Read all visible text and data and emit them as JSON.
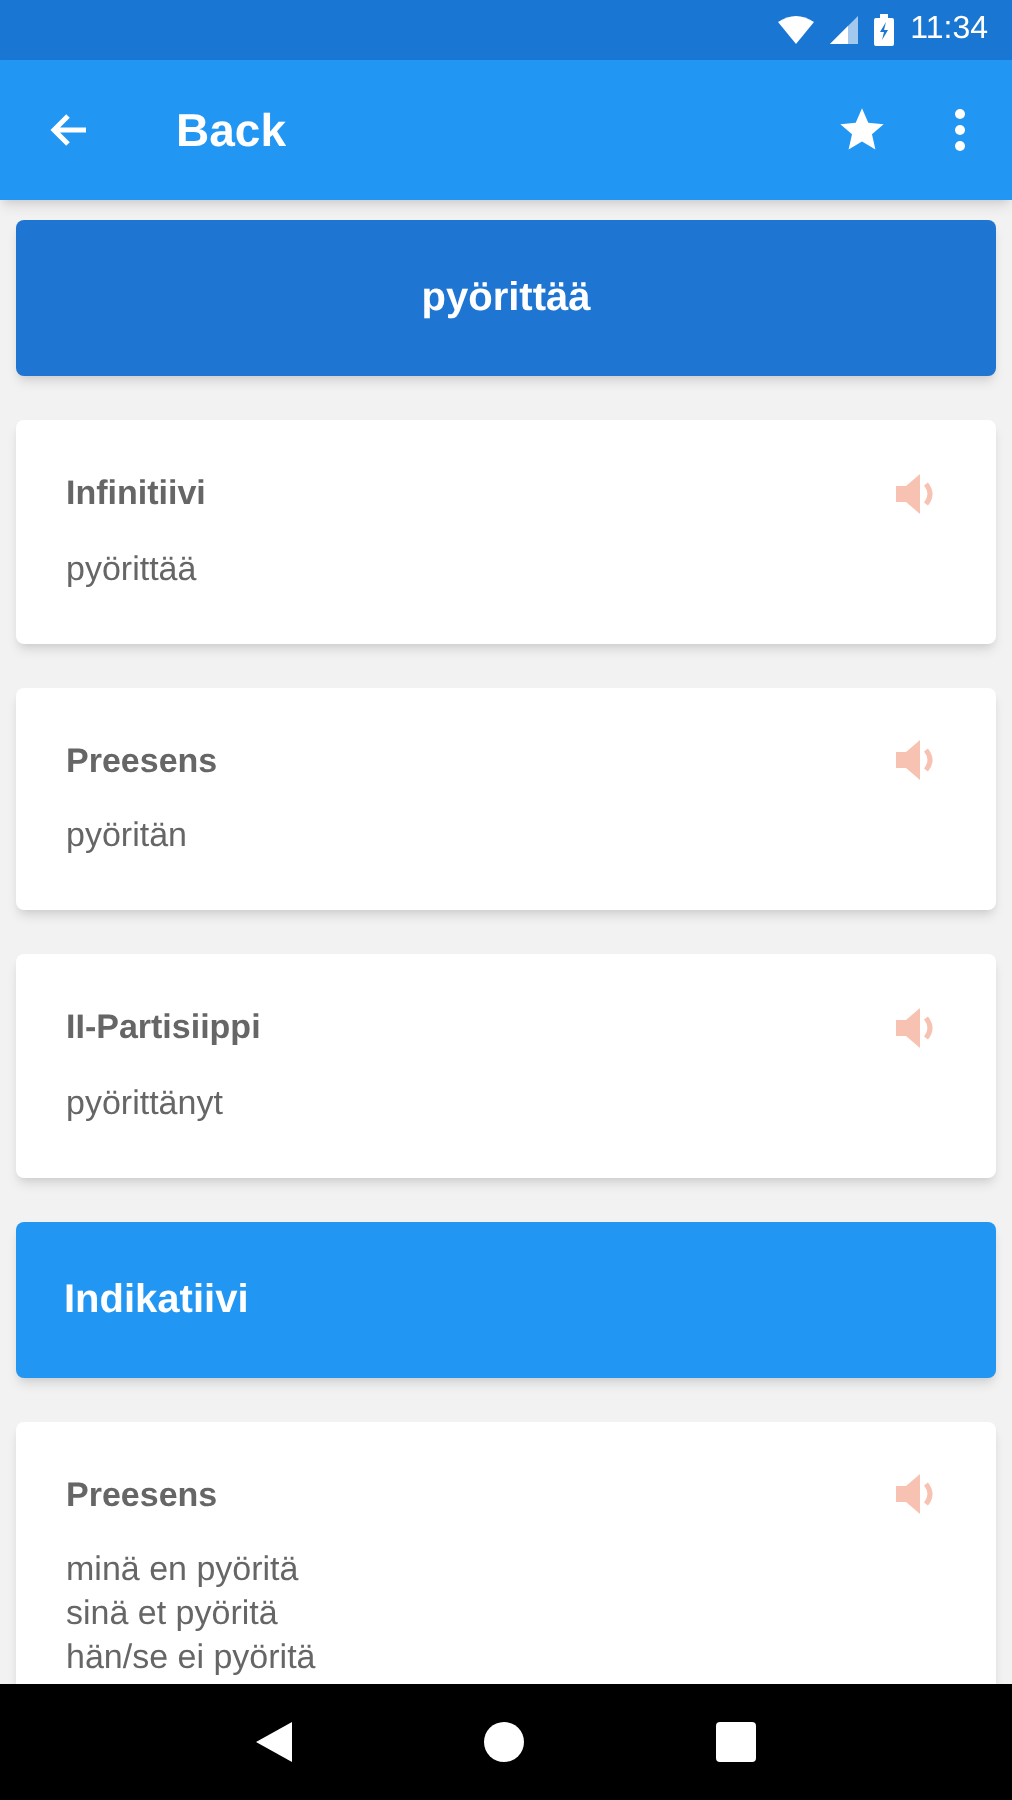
{
  "status_bar": {
    "time": "11:34"
  },
  "toolbar": {
    "title": "Back"
  },
  "header": {
    "word": "pyörittää"
  },
  "items": [
    {
      "kind": "form",
      "title": "Infinitiivi",
      "lines": [
        "pyörittää"
      ]
    },
    {
      "kind": "form",
      "title": "Preesens",
      "lines": [
        "pyöritän"
      ]
    },
    {
      "kind": "form",
      "title": "II-Partisiippi",
      "lines": [
        "pyörittänyt"
      ]
    },
    {
      "kind": "section",
      "title": "Indikatiivi"
    },
    {
      "kind": "form",
      "title": "Preesens",
      "lines": [
        "minä en pyöritä",
        "sinä et pyöritä",
        "hän/se ei pyöritä"
      ]
    }
  ]
}
